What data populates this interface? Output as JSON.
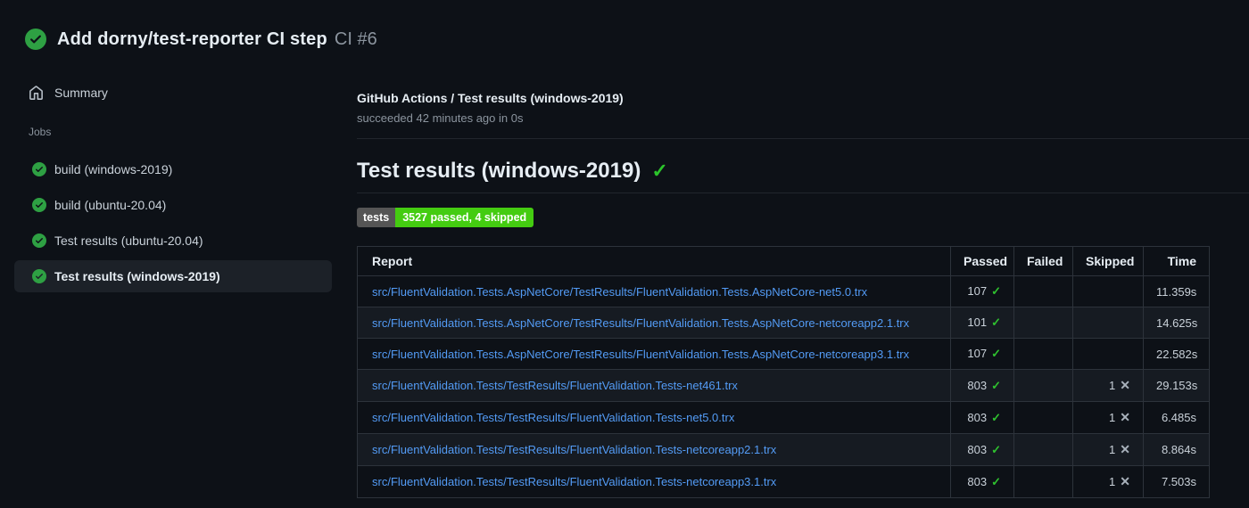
{
  "header": {
    "status": "success",
    "title": "Add dorny/test-reporter CI step",
    "run_number": "CI #6"
  },
  "sidebar": {
    "summary_label": "Summary",
    "jobs_label": "Jobs",
    "jobs": [
      {
        "label": "build (windows-2019)",
        "status": "success",
        "selected": false
      },
      {
        "label": "build (ubuntu-20.04)",
        "status": "success",
        "selected": false
      },
      {
        "label": "Test results (ubuntu-20.04)",
        "status": "success",
        "selected": false
      },
      {
        "label": "Test results (windows-2019)",
        "status": "success",
        "selected": true
      }
    ]
  },
  "main": {
    "check_title": "GitHub Actions / Test results (windows-2019)",
    "check_status_line": "succeeded 42 minutes ago in 0s",
    "section_title": "Test results (windows-2019)",
    "badge": {
      "label": "tests",
      "value": "3527 passed, 4 skipped",
      "label_bg": "#555555",
      "value_bg": "#44cc11"
    },
    "table": {
      "columns": [
        "Report",
        "Passed",
        "Failed",
        "Skipped",
        "Time"
      ],
      "rows": [
        {
          "report": "src/FluentValidation.Tests.AspNetCore/TestResults/FluentValidation.Tests.AspNetCore-net5.0.trx",
          "passed": "107",
          "failed": "",
          "skipped": "",
          "time": "11.359s"
        },
        {
          "report": "src/FluentValidation.Tests.AspNetCore/TestResults/FluentValidation.Tests.AspNetCore-netcoreapp2.1.trx",
          "passed": "101",
          "failed": "",
          "skipped": "",
          "time": "14.625s"
        },
        {
          "report": "src/FluentValidation.Tests.AspNetCore/TestResults/FluentValidation.Tests.AspNetCore-netcoreapp3.1.trx",
          "passed": "107",
          "failed": "",
          "skipped": "",
          "time": "22.582s"
        },
        {
          "report": "src/FluentValidation.Tests/TestResults/FluentValidation.Tests-net461.trx",
          "passed": "803",
          "failed": "",
          "skipped": "1",
          "time": "29.153s"
        },
        {
          "report": "src/FluentValidation.Tests/TestResults/FluentValidation.Tests-net5.0.trx",
          "passed": "803",
          "failed": "",
          "skipped": "1",
          "time": "6.485s"
        },
        {
          "report": "src/FluentValidation.Tests/TestResults/FluentValidation.Tests-netcoreapp2.1.trx",
          "passed": "803",
          "failed": "",
          "skipped": "1",
          "time": "8.864s"
        },
        {
          "report": "src/FluentValidation.Tests/TestResults/FluentValidation.Tests-netcoreapp3.1.trx",
          "passed": "803",
          "failed": "",
          "skipped": "1",
          "time": "7.503s"
        }
      ]
    }
  },
  "icons": {
    "passed_glyph": "✓",
    "skipped_glyph": "✕",
    "section_check_glyph": "✓"
  },
  "colors": {
    "background": "#0d1117",
    "link_blue": "#539bf5",
    "success_circle_green": "#2ea043",
    "check_green": "#2fc12f",
    "muted_text": "#8b949e",
    "selected_item_bg": "#1c2128",
    "table_border": "#2d333b",
    "row_alt_bg": "#161b22"
  }
}
